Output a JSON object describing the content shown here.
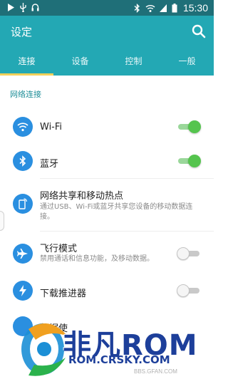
{
  "status_bar": {
    "time": "15:30"
  },
  "app_bar": {
    "title": "设定"
  },
  "tabs": [
    {
      "label": "连接",
      "active": true
    },
    {
      "label": "设备",
      "active": false
    },
    {
      "label": "控制",
      "active": false
    },
    {
      "label": "一般",
      "active": false
    }
  ],
  "section": {
    "header": "网络连接"
  },
  "rows": {
    "wifi": {
      "title": "Wi-Fi",
      "toggle": "on"
    },
    "bluetooth": {
      "title": "蓝牙",
      "toggle": "on"
    },
    "tethering": {
      "title": "网络共享和移动热点",
      "subtitle": "通过USB、Wi-Fi或蓝牙共享您设备的移动数据连接。"
    },
    "airplane": {
      "title": "飞行模式",
      "subtitle": "禁用通话和信息功能，及移动数据。",
      "toggle": "off"
    },
    "download_booster": {
      "title": "下载推进器",
      "toggle": "off"
    },
    "partial": {
      "title": "数据使"
    }
  },
  "watermark": {
    "brand": "非凡ROM",
    "domain": "ROM.CRSKY.COM",
    "small": "BBS.GFAN.COM"
  },
  "colors": {
    "status_bar": "#1f6f78",
    "app_bar": "#23a8b4",
    "tab_indicator": "#f2d15a",
    "section_header": "#1f8e98",
    "icon_circle": "#2a8fe0",
    "toggle_on": "#55c44e",
    "toggle_off": "#c9c9c9"
  }
}
